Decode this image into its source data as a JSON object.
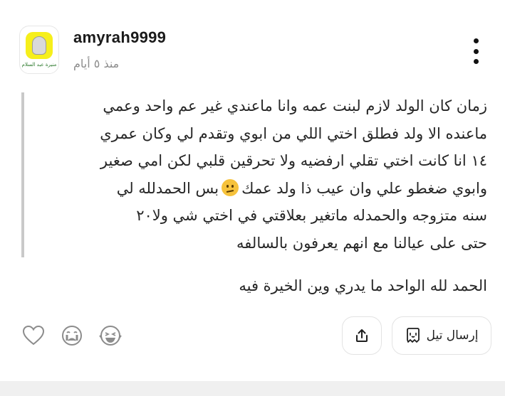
{
  "post": {
    "username": "amyrah9999",
    "timestamp": "منذ ٥ أيام",
    "avatar_caption": "منيرة عبد السلام",
    "quote_lines": [
      "زمان كان الولد لازم لبنت عمه وانا ماعندي غير عم واحد وعمي",
      "ماعنده الا ولد فطلق اختي اللي من ابوي وتقدم لي وكان عمري",
      "١٤ انا كانت اختي تقلي ارفضيه ولا تحرقين قلبي لكن امي صغير",
      "وابوي ضغطو علي وان عيب ذا ولد عمك",
      "بس الحمدلله لي",
      "سنه متزوجه والحمدله ماتغير بعلاقتي في اختي شي ولا٢٠",
      "حتى على عيالنا مع انهم يعرفون بالسالفه"
    ],
    "caption": "الحمد لله الواحد ما يدري وين الخيرة فيه"
  },
  "actions": {
    "send_label": "إرسال تيل",
    "icons": [
      "heart-icon",
      "crying-face-icon",
      "laughing-face-icon",
      "share-icon",
      "chat-icon",
      "more-icon"
    ]
  }
}
